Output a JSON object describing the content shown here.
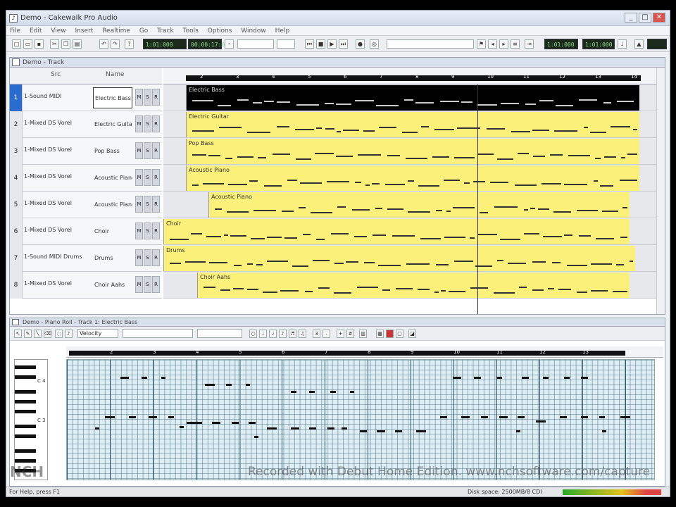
{
  "window": {
    "title": "Demo - Cakewalk Pro Audio",
    "buttons": {
      "minimize": "_",
      "maximize": "□",
      "close": "✕"
    }
  },
  "menu": [
    "File",
    "Edit",
    "View",
    "Insert",
    "Realtime",
    "Go",
    "Track",
    "Tools",
    "Options",
    "Window",
    "Help"
  ],
  "toolbar": {
    "now_time": "1:01:000",
    "smpte": "00:00:17:00",
    "counter_small": "1:01:000",
    "range": "1:01:000"
  },
  "track_view": {
    "title": "Demo - Track",
    "columns": {
      "name": "Name",
      "source": "Src"
    },
    "tracks": [
      {
        "num": "1",
        "name": "1-Sound MIDI",
        "instrument": "Electric Bass",
        "m": "M",
        "s": "S",
        "r": "R"
      },
      {
        "num": "2",
        "name": "1-Mixed DS Vorel",
        "instrument": "Electric Guitar",
        "m": "M",
        "s": "S",
        "r": "R"
      },
      {
        "num": "3",
        "name": "1-Mixed DS Vorel",
        "instrument": "Pop Bass",
        "m": "M",
        "s": "S",
        "r": "R"
      },
      {
        "num": "4",
        "name": "1-Mixed DS Vorel",
        "instrument": "Acoustic Piano",
        "m": "M",
        "s": "S",
        "r": "R"
      },
      {
        "num": "5",
        "name": "1-Mixed DS Vorel",
        "instrument": "Acoustic Piano",
        "m": "M",
        "s": "S",
        "r": "R"
      },
      {
        "num": "6",
        "name": "1-Mixed DS Vorel",
        "instrument": "Choir",
        "m": "M",
        "s": "S",
        "r": "R"
      },
      {
        "num": "7",
        "name": "1-Sound MIDI Drums",
        "instrument": "Drums",
        "m": "M",
        "s": "S",
        "r": "R"
      },
      {
        "num": "8",
        "name": "1-Mixed DS Vorel",
        "instrument": "Choir Aahs",
        "m": "M",
        "s": "S",
        "r": "R"
      }
    ],
    "ruler_marks": [
      "2",
      "3",
      "4",
      "5",
      "6",
      "7",
      "8",
      "9",
      "10",
      "11",
      "12",
      "13",
      "14"
    ],
    "clips": [
      {
        "label": "Electric Bass",
        "style": "black"
      },
      {
        "label": "Electric Guitar",
        "style": "yellow"
      },
      {
        "label": "Pop Bass",
        "style": "yellow"
      },
      {
        "label": "Acoustic Piano",
        "style": "yellow"
      },
      {
        "label": "Acoustic Piano",
        "style": "yellow"
      },
      {
        "label": "Choir",
        "style": "yellow"
      },
      {
        "label": "Drums",
        "style": "yellow"
      },
      {
        "label": "Choir Aahs",
        "style": "yellow"
      }
    ]
  },
  "piano_roll": {
    "title": "Demo - Piano Roll - Track 1: Electric Bass",
    "velocity_combo": "Velocity",
    "ruler_marks": [
      "2",
      "3",
      "4",
      "5",
      "6",
      "7",
      "8",
      "9",
      "10",
      "11",
      "12",
      "13",
      "14"
    ],
    "key_labels": [
      "C 4",
      "C 3"
    ]
  },
  "status": {
    "left": "For Help, press F1",
    "right": "Disk space: 2500MB/8 CDI"
  },
  "overlay": {
    "watermark": "Recorded with Debut Home Edition. www.nchsoftware.com/capture",
    "logo": "NCH"
  },
  "colors": {
    "clip_yellow": "#faf07a",
    "selected_track": "#2b6cd1",
    "grid_bg": "#dfeef4"
  }
}
